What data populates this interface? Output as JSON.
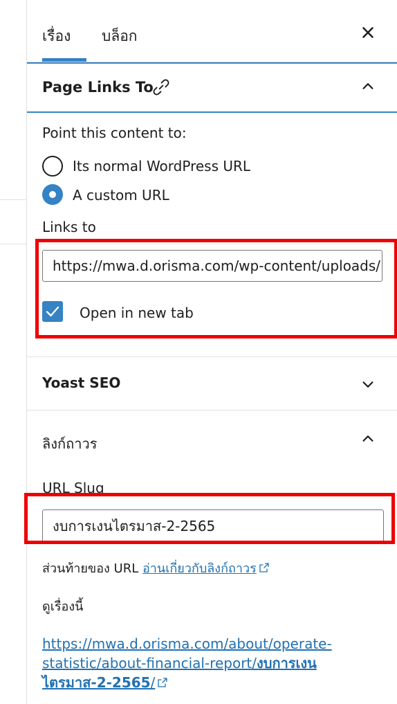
{
  "tabs": {
    "document_label": "เรื่อง",
    "block_label": "บล็อก"
  },
  "page_links_to": {
    "title": "Page Links To",
    "prompt": "Point this content to:",
    "options": [
      {
        "label": "Its normal WordPress URL",
        "selected": false
      },
      {
        "label": "A custom URL",
        "selected": true
      }
    ],
    "links_to_label": "Links to",
    "url_value": "https://mwa.d.orisma.com/wp-content/uploads/",
    "open_new_tab_label": "Open in new tab",
    "open_new_tab_checked": true
  },
  "yoast": {
    "title": "Yoast SEO"
  },
  "permalink": {
    "title": "ลิงก์ถาวร",
    "slug_label": "URL Slug",
    "slug_value": "งบการเงนไตรมาส-2-2565",
    "help_prefix": "ส่วนท้ายของ URL",
    "help_link": "อ่านเกี่ยวกับลิงก์ถาวร",
    "view_label": "ดูเรื่องนี้",
    "full_url_line1": "https://mwa.d.orisma.com/about/operate-",
    "full_url_line2_plain": "statistic/about-financial-report/",
    "full_url_line2_bold": "งบการเงน",
    "full_url_line3_bold": "ไตรมาส-2-2565",
    "full_url_line3_tail": "/"
  },
  "colors": {
    "accent": "#3582c4",
    "link": "#2271b1",
    "highlight": "#ee0000"
  }
}
